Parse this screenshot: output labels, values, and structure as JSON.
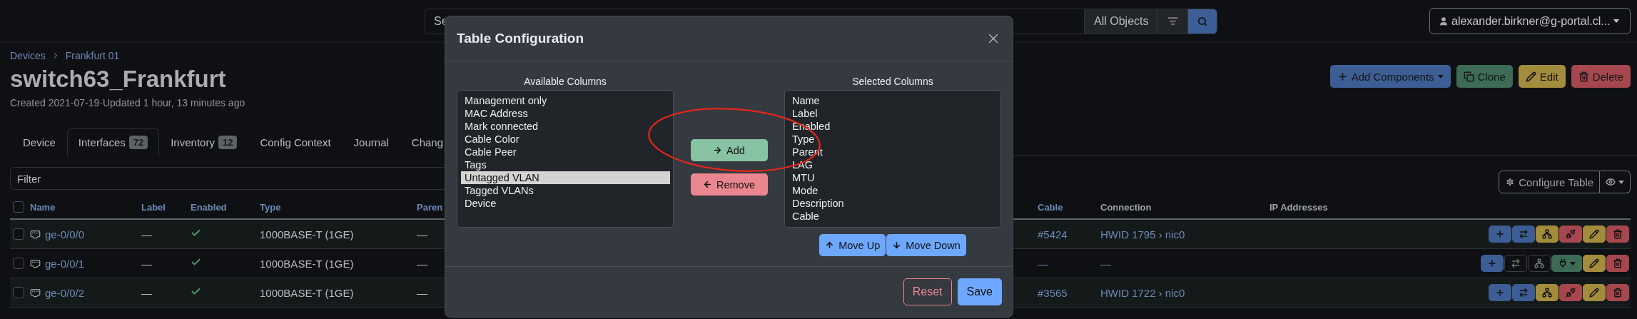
{
  "navbar": {
    "search": {
      "placeholder": "Se"
    },
    "scope": "All Objects",
    "user": "alexander.birkner@g-portal.cl..."
  },
  "breadcrumbs": [
    "Devices",
    "Frankfurt 01"
  ],
  "title": "switch63_Frankfurt",
  "meta": "Created 2021-07-19·Updated 1 hour, 13 minutes ago",
  "page_actions": [
    {
      "kind": "add",
      "label": "Add Components"
    },
    {
      "kind": "clone",
      "label": "Clone"
    },
    {
      "kind": "edit",
      "label": "Edit"
    },
    {
      "kind": "delete",
      "label": "Delete"
    }
  ],
  "tabs": [
    {
      "label": "Device",
      "selected": false
    },
    {
      "label": "Interfaces",
      "badge": "72",
      "selected": true
    },
    {
      "label": "Inventory",
      "badge": "12",
      "selected": false
    },
    {
      "label": "Config Context",
      "selected": false
    },
    {
      "label": "Journal",
      "selected": false
    },
    {
      "label": "Chang",
      "selected": false
    }
  ],
  "filter": {
    "placeholder": "Filter"
  },
  "configure_table": {
    "label": "Configure Table"
  },
  "table": {
    "select_all": {
      "checked": false
    },
    "columns_left": [
      {
        "label": "Name",
        "sortable": true
      },
      {
        "label": "Label",
        "sortable": true
      },
      {
        "label": "Enabled",
        "sortable": true
      },
      {
        "label": "Type",
        "sortable": true
      },
      {
        "label": "Paren",
        "sortable": true
      }
    ],
    "columns_right": [
      {
        "label": "Cable",
        "sortable": true
      },
      {
        "label": "Connection",
        "sortable": false
      },
      {
        "label": "IP Addresses",
        "sortable": false
      }
    ],
    "rows": [
      {
        "checked": false,
        "name": "ge-0/0/0",
        "label": "—",
        "enabled": true,
        "type": "1000BASE-T (1GE)",
        "parent": "—",
        "cable": "#5424",
        "connection": "HWID 1795 › nic0",
        "actions": [
          {
            "kind": "add",
            "disabled": false
          },
          {
            "kind": "trace",
            "disabled": false
          },
          {
            "kind": "disconnect",
            "disabled": false
          },
          {
            "kind": "unplug",
            "disabled": false
          },
          {
            "kind": "edit",
            "disabled": false
          },
          {
            "kind": "delete",
            "disabled": false
          }
        ]
      },
      {
        "checked": false,
        "name": "ge-0/0/1",
        "label": "—",
        "enabled": true,
        "type": "1000BASE-T (1GE)",
        "parent": "—",
        "cable": "—",
        "connection": "—",
        "actions": [
          {
            "kind": "add",
            "disabled": false
          },
          {
            "kind": "trace",
            "disabled": true
          },
          {
            "kind": "disconnect",
            "disabled": true
          },
          {
            "kind": "connect",
            "disabled": false
          },
          {
            "kind": "edit",
            "disabled": false
          },
          {
            "kind": "delete",
            "disabled": false
          }
        ]
      },
      {
        "checked": false,
        "name": "ge-0/0/2",
        "label": "—",
        "enabled": true,
        "type": "1000BASE-T (1GE)",
        "parent": "—",
        "cable": "#3565",
        "connection": "HWID 1722 › nic0",
        "actions": [
          {
            "kind": "add",
            "disabled": false
          },
          {
            "kind": "trace",
            "disabled": false
          },
          {
            "kind": "disconnect",
            "disabled": false
          },
          {
            "kind": "unplug",
            "disabled": false
          },
          {
            "kind": "edit",
            "disabled": false
          },
          {
            "kind": "delete",
            "disabled": false
          }
        ]
      }
    ]
  },
  "modal": {
    "title": "Table Configuration",
    "available": {
      "label": "Available Columns",
      "items": [
        {
          "label": "Management only",
          "selected": false
        },
        {
          "label": "MAC Address",
          "selected": false
        },
        {
          "label": "Mark connected",
          "selected": false
        },
        {
          "label": "Cable Color",
          "selected": false
        },
        {
          "label": "Cable Peer",
          "selected": false
        },
        {
          "label": "Tags",
          "selected": false
        },
        {
          "label": "Untagged VLAN",
          "selected": true
        },
        {
          "label": "Tagged VLANs",
          "selected": false
        },
        {
          "label": "Device",
          "selected": false
        }
      ]
    },
    "selected": {
      "label": "Selected Columns",
      "items": [
        {
          "label": "Name",
          "selected": false
        },
        {
          "label": "Label",
          "selected": false
        },
        {
          "label": "Enabled",
          "selected": false
        },
        {
          "label": "Type",
          "selected": false
        },
        {
          "label": "Parent",
          "selected": false
        },
        {
          "label": "LAG",
          "selected": false
        },
        {
          "label": "MTU",
          "selected": false
        },
        {
          "label": "Mode",
          "selected": false
        },
        {
          "label": "Description",
          "selected": false
        },
        {
          "label": "Cable",
          "selected": false
        }
      ]
    },
    "transfer_buttons": [
      {
        "kind": "add",
        "label": "Add"
      },
      {
        "kind": "remove",
        "label": "Remove"
      }
    ],
    "order_buttons": [
      {
        "kind": "up",
        "label": "Move Up"
      },
      {
        "kind": "down",
        "label": "Move Down"
      }
    ],
    "footer_buttons": [
      {
        "kind": "reset",
        "label": "Reset"
      },
      {
        "kind": "save",
        "label": "Save"
      }
    ]
  }
}
